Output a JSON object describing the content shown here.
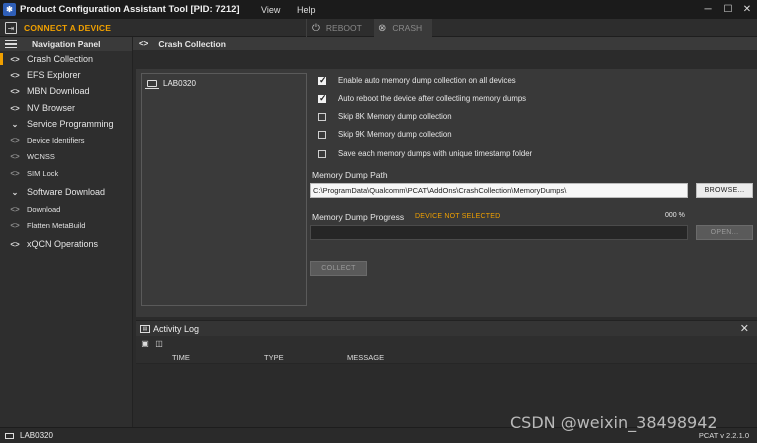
{
  "window": {
    "title": "Product Configuration Assistant Tool [PID: 7212]",
    "menu": [
      "View",
      "Help"
    ],
    "controls": [
      "minimize",
      "maximize",
      "close"
    ]
  },
  "toolbar": {
    "connect_label": "CONNECT A DEVICE",
    "reboot_label": "REBOOT",
    "crash_label": "CRASH"
  },
  "sidebar": {
    "header": "Navigation Panel",
    "items": [
      {
        "label": "Crash Collection",
        "icon": "code-icon"
      },
      {
        "label": "EFS Explorer",
        "icon": "code-icon"
      },
      {
        "label": "MBN Download",
        "icon": "code-icon"
      },
      {
        "label": "NV Browser",
        "icon": "code-icon"
      },
      {
        "label": "Service Programming",
        "icon": "chevron-down-icon"
      },
      {
        "label": "Device Identifiers",
        "icon": "code-icon"
      },
      {
        "label": "WCNSS",
        "icon": "code-icon"
      },
      {
        "label": "SIM Lock",
        "icon": "code-icon"
      },
      {
        "label": "Software Download",
        "icon": "chevron-down-icon"
      },
      {
        "label": "Download",
        "icon": "code-icon"
      },
      {
        "label": "Flatten MetaBuild",
        "icon": "code-icon"
      },
      {
        "label": "xQCN Operations",
        "icon": "code-icon"
      }
    ]
  },
  "main": {
    "title": "Crash Collection",
    "devices": [
      "LAB0320"
    ],
    "options": [
      {
        "label": "Enable auto memory dump collection on all devices",
        "checked": true
      },
      {
        "label": "Auto reboot the device after collectiing memory dumps",
        "checked": true
      },
      {
        "label": "Skip 8K Memory dump collection",
        "checked": false
      },
      {
        "label": "Skip 9K Memory dump collection",
        "checked": false
      },
      {
        "label": "Save each memory dumps with unique timestamp folder",
        "checked": false
      }
    ],
    "path_label": "Memory Dump Path",
    "path_value": "C:\\ProgramData\\Qualcomm\\PCAT\\AddOns\\CrashCollection\\MemoryDumps\\",
    "browse_label": "BROWSE...",
    "progress_label": "Memory Dump Progress",
    "progress_status": "DEVICE NOT SELECTED",
    "progress_pct": "000 %",
    "progress_value": 0,
    "open_label": "OPEN...",
    "collect_label": "COLLECT"
  },
  "activity_log": {
    "title": "Activity Log",
    "columns": [
      "TIME",
      "TYPE",
      "MESSAGE"
    ]
  },
  "status": {
    "device": "LAB0320",
    "version": "PCAT v 2.2.1.0"
  },
  "watermark": "CSDN @weixin_38498942",
  "colors": {
    "accent": "#f0a000",
    "background": "#2b2b2b",
    "panel": "#393939"
  }
}
